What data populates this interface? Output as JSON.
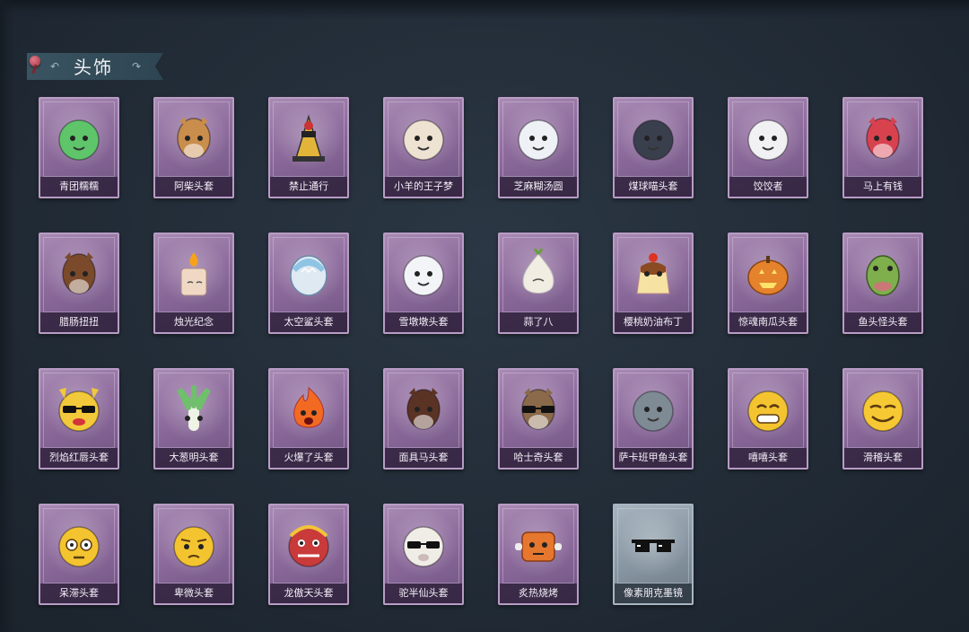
{
  "section": {
    "title": "头饰"
  },
  "items": [
    {
      "label": "青团糯糯",
      "icon": "green-dumpling-icon",
      "frame": "purple",
      "color": "#5fc56a"
    },
    {
      "label": "阿柴头套",
      "icon": "shiba-dog-icon",
      "frame": "purple",
      "color": "#c98d4c"
    },
    {
      "label": "禁止通行",
      "icon": "traffic-cone-icon",
      "frame": "purple",
      "color": "#e2b53a"
    },
    {
      "label": "小羊的王子梦",
      "icon": "sheep-crown-icon",
      "frame": "purple",
      "color": "#eee3d2"
    },
    {
      "label": "芝麻糊汤圆",
      "icon": "rice-ball-icon",
      "frame": "purple",
      "color": "#eef2f6"
    },
    {
      "label": "煤球喵头套",
      "icon": "black-cat-icon",
      "frame": "purple",
      "color": "#3a3f4d"
    },
    {
      "label": "饺饺者",
      "icon": "dumpling-icon",
      "frame": "purple",
      "color": "#f1f1f4"
    },
    {
      "label": "马上有钱",
      "icon": "red-horse-icon",
      "frame": "purple",
      "color": "#d8414e"
    },
    {
      "label": "腊肠扭扭",
      "icon": "dachshund-icon",
      "frame": "purple",
      "color": "#7a4a2a"
    },
    {
      "label": "烛光纪念",
      "icon": "candle-icon",
      "frame": "purple",
      "color": "#f0d9c4"
    },
    {
      "label": "太空鲨头套",
      "icon": "shark-icon",
      "frame": "purple",
      "color": "#8fc4e4"
    },
    {
      "label": "雪墩墩头套",
      "icon": "snowman-icon",
      "frame": "purple",
      "color": "#f3f4f8"
    },
    {
      "label": "蒜了八",
      "icon": "garlic-icon",
      "frame": "purple",
      "color": "#f2ede2"
    },
    {
      "label": "樱桃奶油布丁",
      "icon": "pudding-icon",
      "frame": "purple",
      "color": "#f1c46a"
    },
    {
      "label": "惊魂南瓜头套",
      "icon": "pumpkin-icon",
      "frame": "purple",
      "color": "#e5822c"
    },
    {
      "label": "鱼头怪头套",
      "icon": "fish-head-icon",
      "frame": "purple",
      "color": "#7fae4c"
    },
    {
      "label": "烈焰红唇头套",
      "icon": "pikachu-sunglasses-icon",
      "frame": "purple",
      "color": "#f2c93a"
    },
    {
      "label": "大葱明头套",
      "icon": "scallion-icon",
      "frame": "purple",
      "color": "#6fc06a"
    },
    {
      "label": "火爆了头套",
      "icon": "fire-icon",
      "frame": "purple",
      "color": "#f26a22"
    },
    {
      "label": "面具马头套",
      "icon": "horse-mask-icon",
      "frame": "purple",
      "color": "#5a3324"
    },
    {
      "label": "哈士奇头套",
      "icon": "husky-sunglasses-icon",
      "frame": "purple",
      "color": "#8a6a4a"
    },
    {
      "label": "萨卡班甲鱼头套",
      "icon": "sacabambaspis-icon",
      "frame": "purple",
      "color": "#7e8a94"
    },
    {
      "label": "嘻嘻头套",
      "icon": "grin-emoji-icon",
      "frame": "purple",
      "color": "#f4c430"
    },
    {
      "label": "滑稽头套",
      "icon": "smirk-emoji-icon",
      "frame": "purple",
      "color": "#f6c833"
    },
    {
      "label": "呆滞头套",
      "icon": "dazed-emoji-icon",
      "frame": "purple",
      "color": "#f4c430"
    },
    {
      "label": "卑微头套",
      "icon": "humble-emoji-icon",
      "frame": "purple",
      "color": "#f4c430"
    },
    {
      "label": "龙傲天头套",
      "icon": "lion-dance-icon",
      "frame": "purple",
      "color": "#c93a3a"
    },
    {
      "label": "驼半仙头套",
      "icon": "alpaca-sunglasses-icon",
      "frame": "purple",
      "color": "#f0ece6"
    },
    {
      "label": "炙热烧烤",
      "icon": "bbq-meat-icon",
      "frame": "purple",
      "color": "#e6772e"
    },
    {
      "label": "像素朋克墨镜",
      "icon": "pixel-sunglasses-icon",
      "frame": "grey",
      "color": "#111111"
    }
  ]
}
